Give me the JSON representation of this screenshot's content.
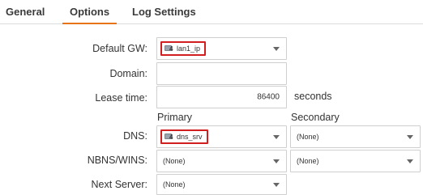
{
  "tabs": [
    {
      "label": "General",
      "active": false
    },
    {
      "label": "Options",
      "active": true
    },
    {
      "label": "Log Settings",
      "active": false
    }
  ],
  "accent_color": "#e8741a",
  "highlight_color": "#d11f1f",
  "form": {
    "default_gw": {
      "label": "Default GW:",
      "value": "lan1_ip",
      "icon": "address-object-icon"
    },
    "domain": {
      "label": "Domain:",
      "value": ""
    },
    "lease_time": {
      "label": "Lease time:",
      "value": "86400",
      "unit": "seconds"
    },
    "columns": {
      "primary": "Primary",
      "secondary": "Secondary"
    },
    "dns": {
      "label": "DNS:",
      "primary": "dns_srv",
      "secondary": "(None)",
      "icon": "address-object-icon"
    },
    "nbns": {
      "label": "NBNS/WINS:",
      "primary": "(None)",
      "secondary": "(None)"
    },
    "next_server": {
      "label": "Next Server:",
      "value": "(None)"
    }
  }
}
